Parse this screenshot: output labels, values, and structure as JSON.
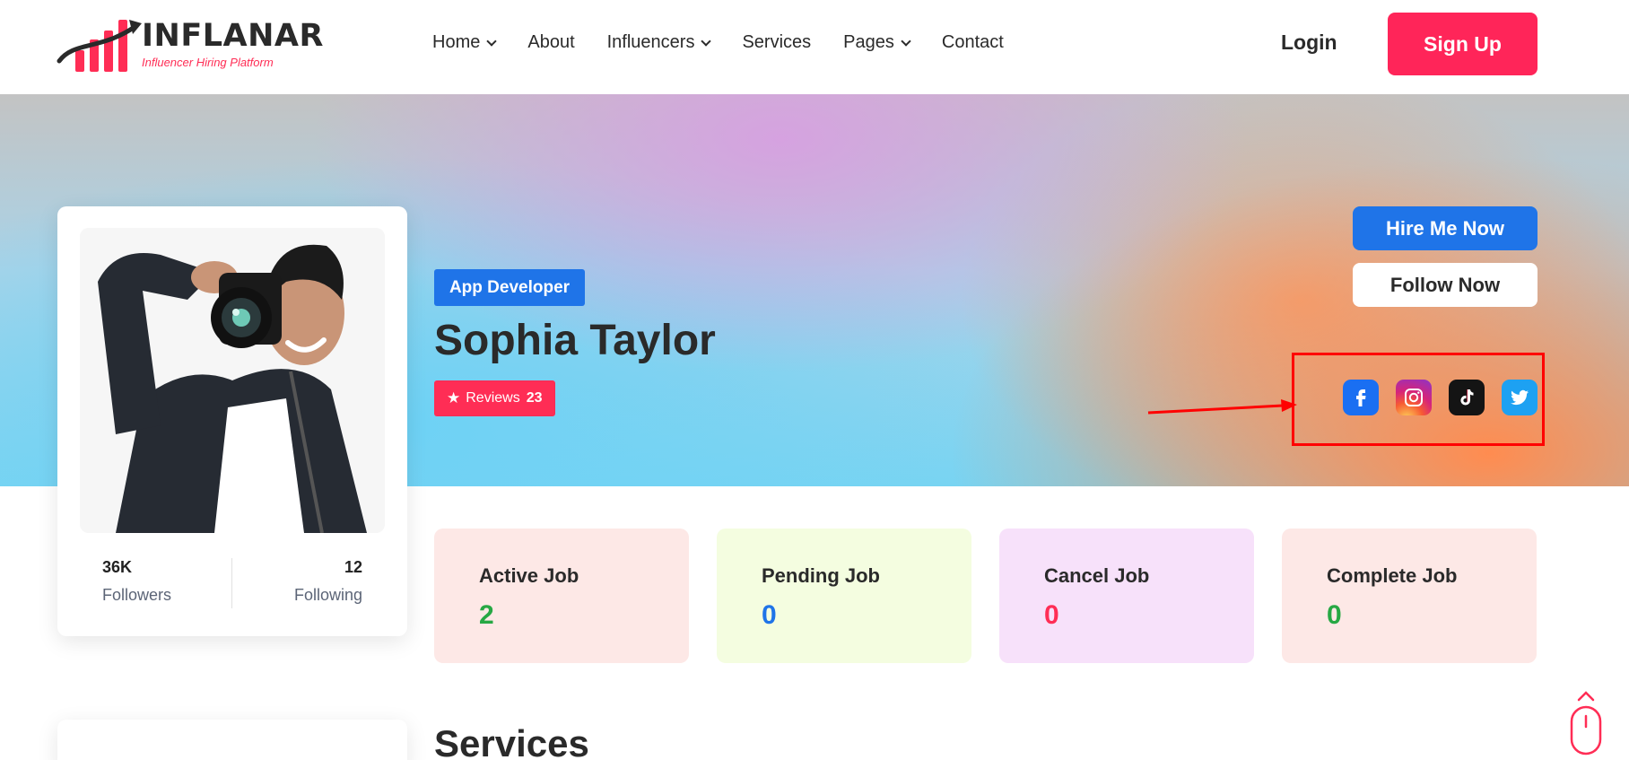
{
  "brand": {
    "name": "INFLANAR",
    "tagline": "Influencer Hiring Platform",
    "accent": "#ff2559"
  },
  "nav": {
    "items": [
      {
        "label": "Home",
        "dropdown": true
      },
      {
        "label": "About",
        "dropdown": false
      },
      {
        "label": "Influencers",
        "dropdown": true
      },
      {
        "label": "Services",
        "dropdown": false
      },
      {
        "label": "Pages",
        "dropdown": true
      },
      {
        "label": "Contact",
        "dropdown": false
      }
    ],
    "login_label": "Login",
    "signup_label": "Sign Up"
  },
  "profile": {
    "role": "App Developer",
    "name": "Sophia Taylor",
    "reviews_label": "Reviews",
    "reviews_count": "23",
    "followers_count": "36K",
    "followers_label": "Followers",
    "following_count": "12",
    "following_label": "Following",
    "hire_label": "Hire Me Now",
    "follow_label": "Follow Now",
    "social": [
      "facebook-icon",
      "instagram-icon",
      "tiktok-icon",
      "twitter-icon"
    ]
  },
  "jobs": [
    {
      "title": "Active Job",
      "value": "2",
      "color": "#27a844"
    },
    {
      "title": "Pending Job",
      "value": "0",
      "color": "#1f74e8"
    },
    {
      "title": "Cancel Job",
      "value": "0",
      "color": "#ff2d55"
    },
    {
      "title": "Complete Job",
      "value": "0",
      "color": "#27a844"
    }
  ],
  "sections": {
    "services_title": "Services"
  },
  "colors": {
    "primary_blue": "#1f74e8",
    "pink": "#ff2d55",
    "annotation_red": "#ff0000"
  }
}
